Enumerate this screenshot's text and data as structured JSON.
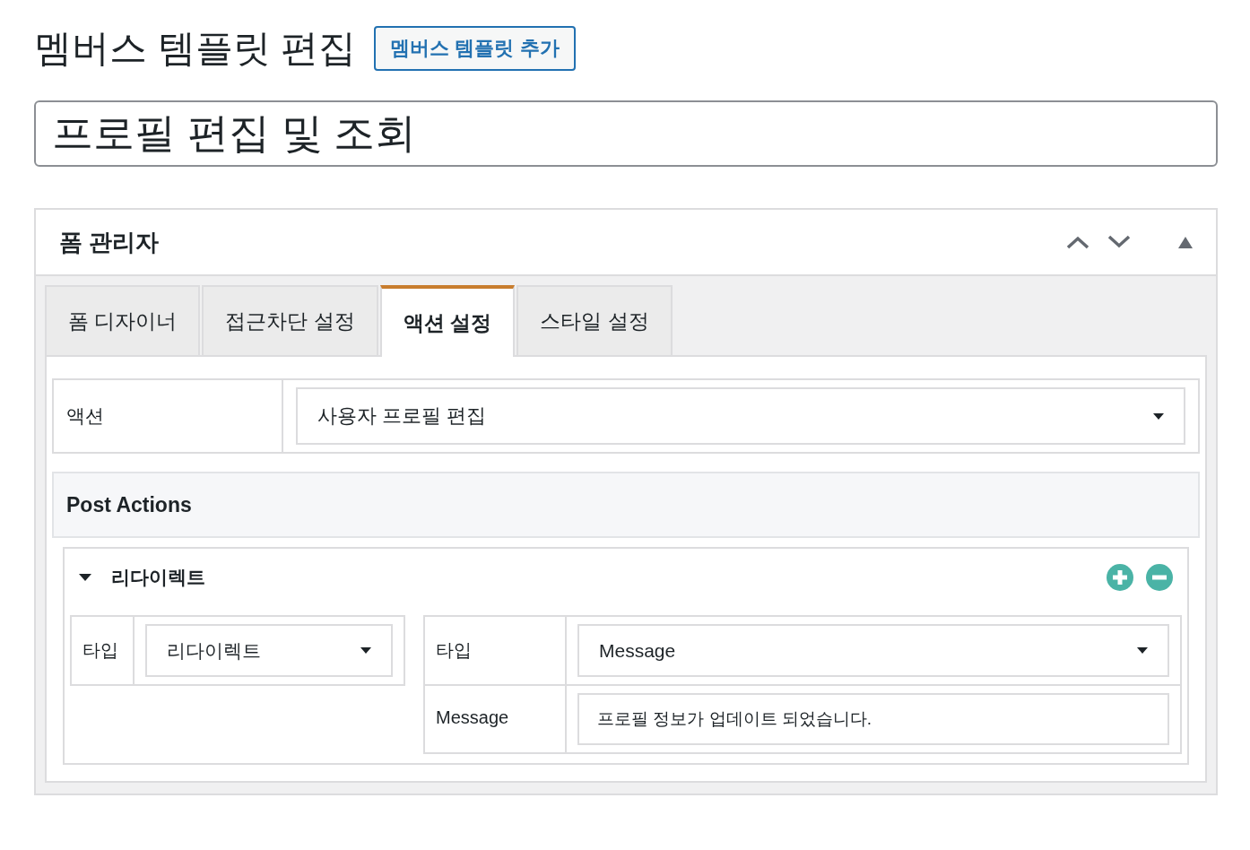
{
  "page_title": "멤버스 템플릿 편집",
  "add_button": "멤버스 템플릿 추가",
  "title_field": {
    "value": "프로필 편집 및 조회"
  },
  "panel": {
    "title": "폼 관리자",
    "expanded": true,
    "tabs": [
      {
        "label": "폼 디자이너",
        "selected": false
      },
      {
        "label": "접근차단 설정",
        "selected": false
      },
      {
        "label": "액션 설정",
        "selected": true
      },
      {
        "label": "스타일 설정",
        "selected": false
      }
    ],
    "action": {
      "label": "액션",
      "value": "사용자 프로필 편집"
    },
    "post_actions": {
      "title": "Post Actions",
      "groups": [
        {
          "title": "리다이렉트",
          "expanded": true,
          "left_fields": [
            {
              "label": "타입",
              "kind": "select",
              "value": "리다이렉트"
            }
          ],
          "right_fields": [
            {
              "label": "타입",
              "kind": "select",
              "value": "Message"
            },
            {
              "label": "Message",
              "kind": "text",
              "value": "프로필 정보가 업데이트 되었습니다."
            }
          ]
        }
      ]
    }
  }
}
